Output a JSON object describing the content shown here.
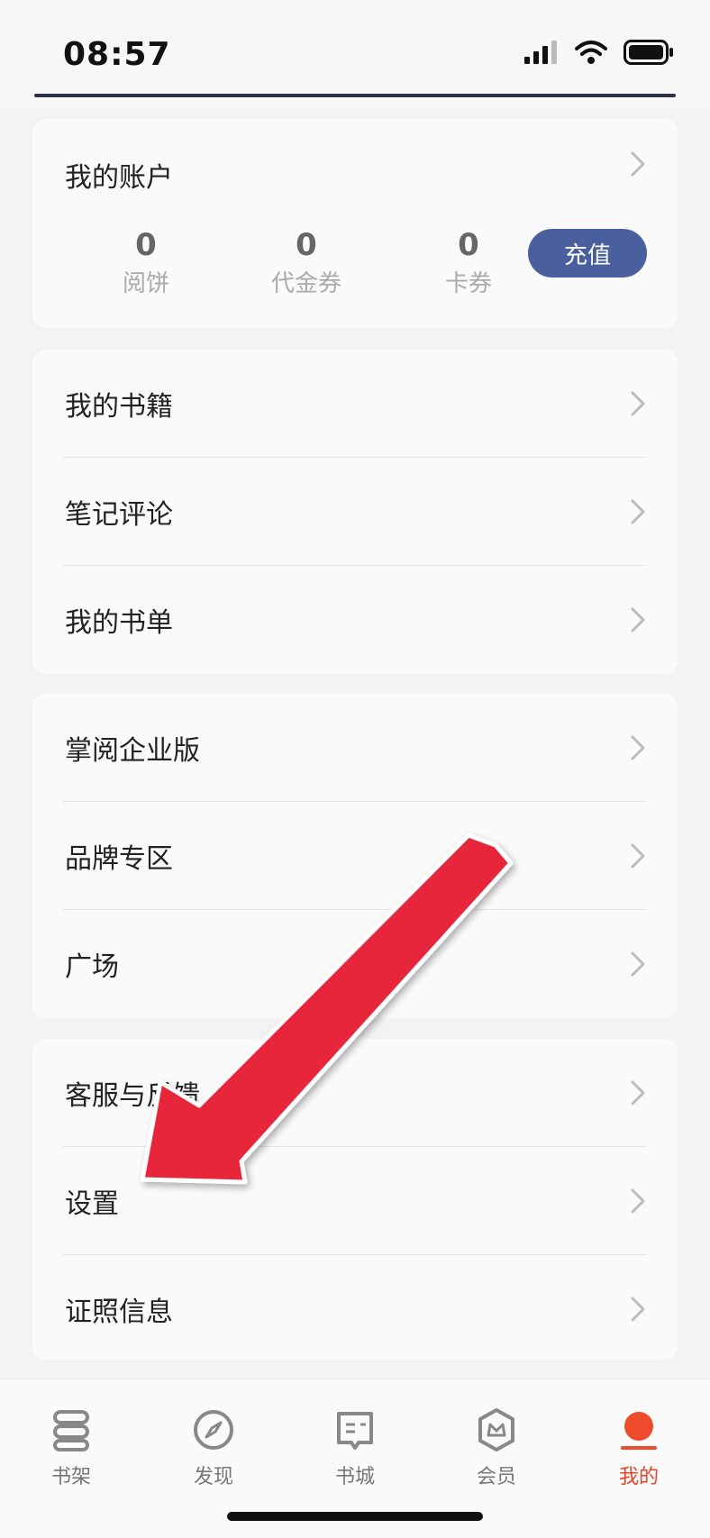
{
  "status_bar": {
    "time": "08:57"
  },
  "account": {
    "title": "我的账户",
    "stats": [
      {
        "value": "0",
        "label": "阅饼"
      },
      {
        "value": "0",
        "label": "代金券"
      },
      {
        "value": "0",
        "label": "卡券"
      }
    ],
    "recharge_label": "充值"
  },
  "section1": {
    "items": [
      {
        "label": "我的书籍"
      },
      {
        "label": "笔记评论"
      },
      {
        "label": "我的书单"
      }
    ]
  },
  "section2": {
    "items": [
      {
        "label": "掌阅企业版"
      },
      {
        "label": "品牌专区"
      },
      {
        "label": "广场"
      }
    ]
  },
  "section3": {
    "items": [
      {
        "label": "客服与反馈"
      },
      {
        "label": "设置"
      },
      {
        "label": "证照信息"
      }
    ]
  },
  "tabbar": {
    "tabs": [
      {
        "label": "书架",
        "icon": "bookshelf-icon"
      },
      {
        "label": "发现",
        "icon": "compass-icon"
      },
      {
        "label": "书城",
        "icon": "book-store-icon"
      },
      {
        "label": "会员",
        "icon": "vip-crown-icon"
      },
      {
        "label": "我的",
        "icon": "profile-icon"
      }
    ],
    "active_index": 4
  },
  "colors": {
    "accent": "#e4432c",
    "recharge_button": "#4a5f9e",
    "annotation_arrow": "#e8273a"
  }
}
